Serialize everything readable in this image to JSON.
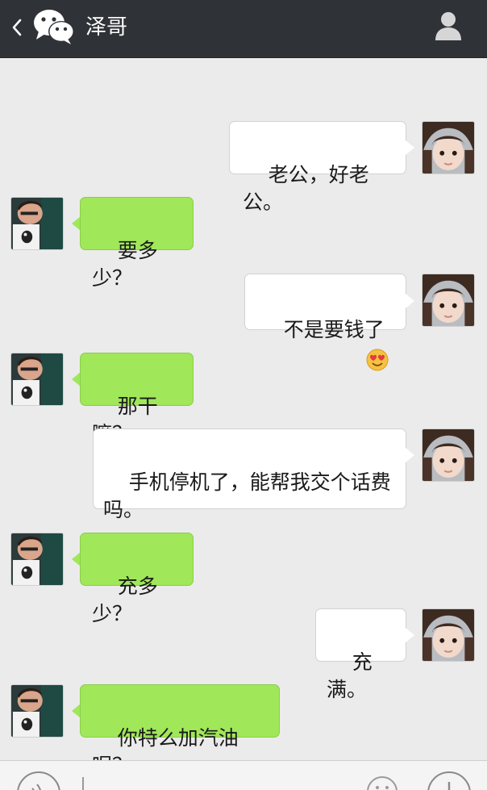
{
  "header": {
    "title": "泽哥"
  },
  "icons": {
    "back": "back-chevron-icon",
    "app_logo": "wechat-logo-icon",
    "profile": "profile-icon",
    "voice": "voice-input-icon",
    "emoji": "emoji-icon",
    "more": "plus-more-icon"
  },
  "colors": {
    "header_bg": "#2f3236",
    "chat_bg": "#ebebeb",
    "bubble_green": "#a0e759",
    "bubble_white": "#ffffff"
  },
  "messages": [
    {
      "side": "right",
      "text": "老公，好老公。"
    },
    {
      "side": "left",
      "text": "要多少？"
    },
    {
      "side": "right",
      "text": "不是要钱了",
      "emoji": "heart-eyes-emoji"
    },
    {
      "side": "left",
      "text": "那干嘛？"
    },
    {
      "side": "right",
      "text": "手机停机了，能帮我交个话费\n吗。"
    },
    {
      "side": "left",
      "text": "充多少？"
    },
    {
      "side": "right",
      "text": "充满。"
    },
    {
      "side": "left",
      "text": "你特么加汽油呢？"
    }
  ]
}
